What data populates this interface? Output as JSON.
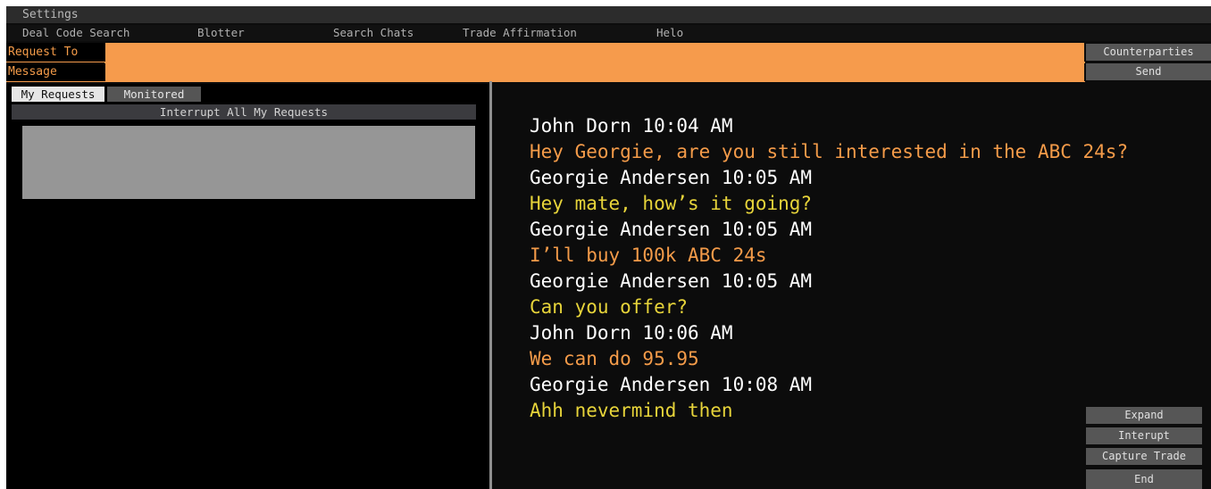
{
  "menu": {
    "settings": "Settings"
  },
  "nav": [
    {
      "label": "Deal Code Search"
    },
    {
      "label": "Blotter"
    },
    {
      "label": "Search Chats"
    },
    {
      "label": "Trade Affirmation"
    },
    {
      "label": "Helo"
    }
  ],
  "request_to": {
    "label": "Request To",
    "value": "",
    "button": "Counterparties"
  },
  "message": {
    "label": "Message",
    "value": "",
    "button": "Send"
  },
  "tabs": {
    "my_requests": "My Requests",
    "monitored": "Monitored"
  },
  "interrupt_all": "Interrupt All My Requests",
  "chat": [
    {
      "header": "John Dorn 10:04 AM",
      "text": "Hey Georgie, are you still interested in the ABC 24s?",
      "color": "#f49b49"
    },
    {
      "header": "Georgie Andersen 10:05 AM",
      "text": "Hey mate, how’s it going?",
      "color": "#e7d43a"
    },
    {
      "header": "Georgie Andersen 10:05 AM",
      "text": "I’ll buy 100k ABC 24s",
      "color": "#f49b49"
    },
    {
      "header": "Georgie Andersen 10:05 AM",
      "text": "Can you offer?",
      "color": "#e7d43a"
    },
    {
      "header": "John Dorn 10:06 AM",
      "text": "We can do 95.95",
      "color": "#f49b49"
    },
    {
      "header": "Georgie Andersen 10:08 AM",
      "text": "Ahh nevermind then",
      "color": "#e7d43a"
    }
  ],
  "actions": {
    "expand": "Expand",
    "interrupt": "Interupt",
    "capture_trade": "Capture Trade",
    "end": "End"
  },
  "colors": {
    "accent": "#f69b4c",
    "label_text": "#f49b49",
    "yellow_text": "#e7d43a",
    "background": "#0c0c0c"
  }
}
